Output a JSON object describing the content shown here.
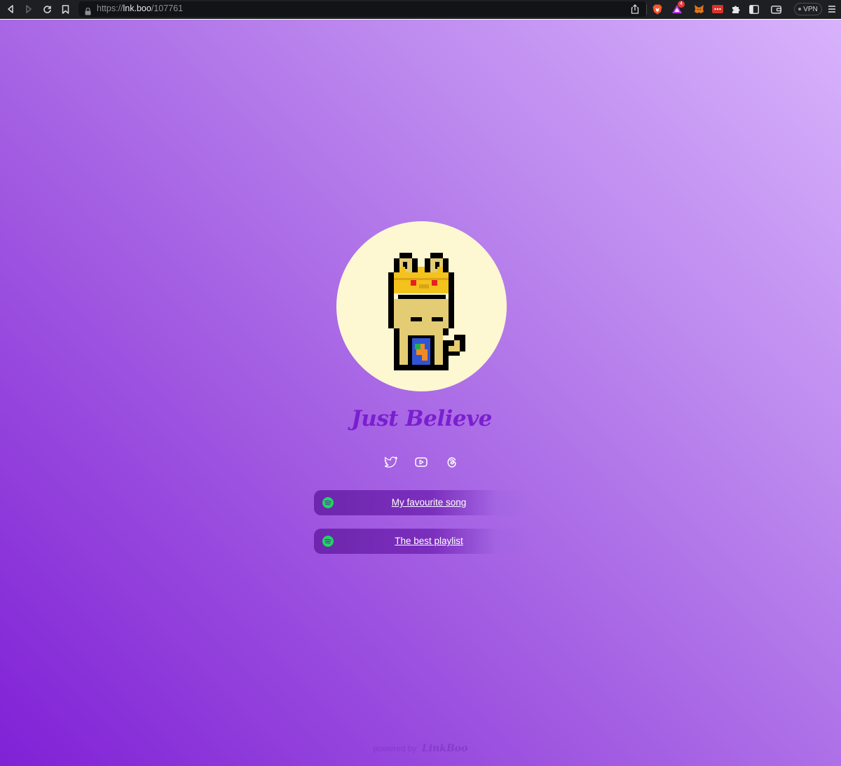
{
  "browser": {
    "url_scheme": "https://",
    "url_host": "lnk.boo",
    "url_path": "/107761",
    "notification_badge": "4",
    "vpn_label": "VPN"
  },
  "icons": {
    "back": "back-icon",
    "forward": "forward-icon",
    "reload": "reload-icon",
    "bookmark": "bookmark-icon",
    "share": "share-icon",
    "brave_shield": "brave-shield-icon",
    "rewards": "rewards-icon",
    "metamask": "metamask-icon",
    "extension_red": "red-extension-icon",
    "puzzle": "extensions-icon",
    "sidebar": "sidebar-icon",
    "wallet": "wallet-icon",
    "menu": "menu-icon"
  },
  "profile": {
    "name": "Just Believe",
    "avatar": "pixel-cat-with-crown"
  },
  "socials": [
    {
      "name": "twitter-icon"
    },
    {
      "name": "youtube-icon"
    },
    {
      "name": "threads-icon"
    }
  ],
  "links": [
    {
      "label": "My favourite song",
      "icon": "spotify-icon"
    },
    {
      "label": "The best playlist",
      "icon": "spotify-icon"
    }
  ],
  "footer": {
    "prefix": "powered by",
    "brand": "LinkBoo"
  },
  "colors": {
    "title": "#7a1fcf",
    "avatar_bg": "#fdf8d2",
    "spotify": "#1ed760",
    "link_bg": "#6d26ad"
  }
}
